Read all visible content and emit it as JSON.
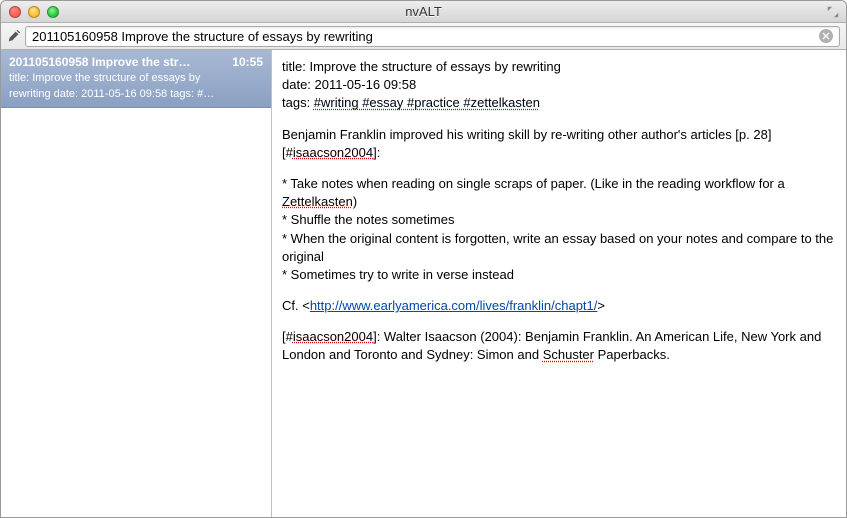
{
  "window": {
    "title": "nvALT"
  },
  "search": {
    "value": "201105160958 Improve the structure of essays by rewriting"
  },
  "sidebar": {
    "items": [
      {
        "title": "201105160958 Improve the str…",
        "time": "10:55",
        "preview_line1": "title: Improve the structure of essays by",
        "preview_line2": "rewriting date: 2011-05-16 09:58 tags: #…"
      }
    ]
  },
  "editor": {
    "meta_title": "title: Improve the structure of essays by rewriting",
    "meta_date": "date: 2011-05-16 09:58",
    "meta_tags_label": "tags: ",
    "meta_tags": "#writing #essay #practice #zettelkasten",
    "intro_a": "Benjamin Franklin improved his writing skill by re-writing other author's articles [p. 28][#",
    "intro_ref": "isaacson2004",
    "intro_b": "]:",
    "bullets": {
      "b1a": "* Take notes when reading on single scraps of paper. (Like in the reading workflow for a ",
      "b1z": "Zettelkasten",
      "b1c": ")",
      "b2": "* Shuffle the notes sometimes",
      "b3": "* When the original content is forgotten, write an essay based on your notes and compare to the original",
      "b4": "* Sometimes try to write in verse instead"
    },
    "cf_label": "Cf. <",
    "cf_link": "http://www.earlyamerica.com/lives/franklin/chapt1/",
    "cf_close": ">",
    "ref_a": "[#",
    "ref_id": "isaacson2004",
    "ref_b": "]: Walter Isaacson (2004):  Benjamin Franklin. An American Life, New York and London and Toronto and Sydney: Simon and ",
    "ref_c": "Schuster",
    "ref_d": " Paperbacks."
  }
}
